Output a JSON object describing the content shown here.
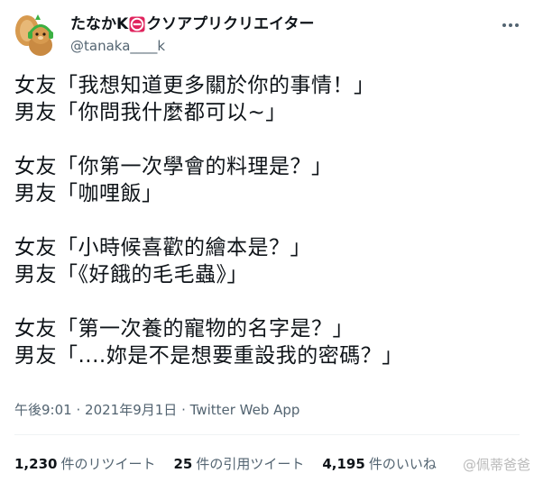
{
  "user": {
    "display_name_prefix": "たなかK",
    "display_name_suffix": "クソアプリクリエイター",
    "handle": "@tanaka____k"
  },
  "tweet": {
    "lines": [
      "女友「我想知道更多關於你的事情！」",
      "男友「你問我什麼都可以~」",
      "",
      "女友「你第一次學會的料理是？」",
      "男友「咖哩飯」",
      "",
      "女友「小時候喜歡的繪本是？」",
      "男友「《好餓的毛毛蟲》」",
      "",
      "女友「第一次養的寵物的名字是？」",
      "男友「....妳是不是想要重設我的密碼？」"
    ],
    "time": "午後9:01",
    "date": "2021年9月1日",
    "separator": "·",
    "source": "Twitter Web App"
  },
  "stats": {
    "retweets_count": "1,230",
    "retweets_label": "件のリツイート",
    "quotes_count": "25",
    "quotes_label": "件の引用ツイート",
    "likes_count": "4,195",
    "likes_label": "件のいいね"
  },
  "watermark": "@佩蒂爸爸",
  "icons": {
    "avatar": "squirrel-avatar",
    "name_badge": "no-entry-icon",
    "more": "more-icon"
  },
  "colors": {
    "text": "#0f1419",
    "secondary": "#536471",
    "badge": "#e0245e"
  }
}
